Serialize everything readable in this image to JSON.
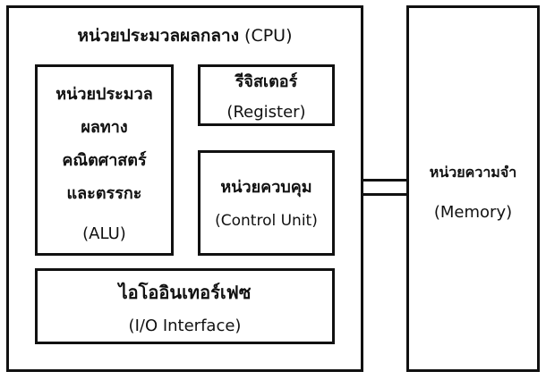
{
  "cpu": {
    "title_th": "หน่วยประมวลผลกลาง",
    "title_en": "(CPU)"
  },
  "alu": {
    "lines": [
      "หน่วยประมวล",
      "ผลทาง",
      "คณิตศาสตร์",
      "และตรรกะ"
    ],
    "en": "(ALU)"
  },
  "register": {
    "th": "รีจิสเตอร์",
    "en": "(Register)"
  },
  "control_unit": {
    "th": "หน่วยควบคุม",
    "en": "(Control Unit)"
  },
  "io": {
    "th": "ไอโออินเทอร์เฟซ",
    "en": "(I/O Interface)"
  },
  "memory": {
    "th": "หน่วยความจำ",
    "en": "(Memory)"
  }
}
